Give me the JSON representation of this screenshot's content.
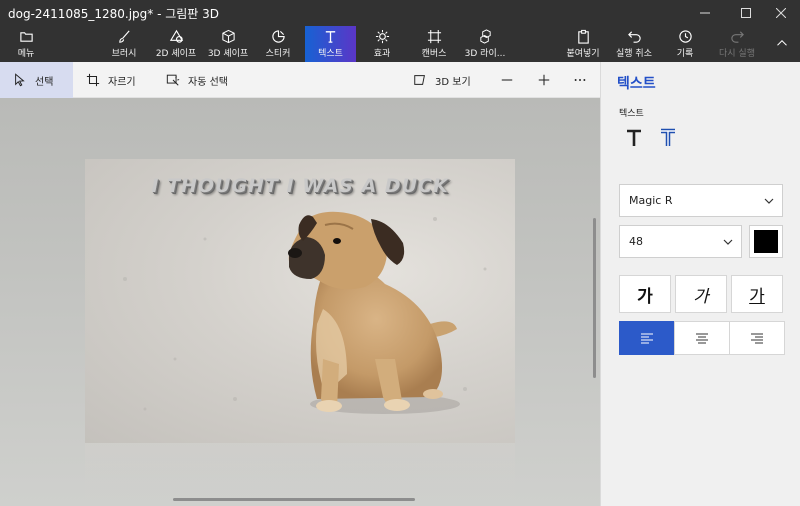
{
  "window": {
    "title": "dog-2411085_1280.jpg* - 그림판 3D",
    "minimize_icon": "minimize-icon",
    "maximize_icon": "maximize-icon",
    "close_icon": "close-icon"
  },
  "ribbon": {
    "menu_label": "메뉴",
    "tools": [
      {
        "label": "브러시",
        "icon": "brush-icon"
      },
      {
        "label": "2D 셰이프",
        "icon": "2d-shapes-icon"
      },
      {
        "label": "3D 셰이프",
        "icon": "3d-shapes-icon"
      },
      {
        "label": "스티커",
        "icon": "sticker-icon"
      },
      {
        "label": "텍스트",
        "icon": "text-icon",
        "active": true
      },
      {
        "label": "효과",
        "icon": "effects-icon"
      },
      {
        "label": "캔버스",
        "icon": "canvas-icon"
      },
      {
        "label": "3D 라이...",
        "icon": "3d-library-icon"
      }
    ],
    "paste_label": "붙여넣기",
    "undo_label": "실행 취소",
    "history_label": "기록",
    "redo_label": "다시 실행",
    "accent_start": "#1762d3",
    "accent_end": "#5b36c7"
  },
  "toolbar": {
    "select_label": "선택",
    "crop_label": "자르기",
    "magic_select_label": "자동 선택",
    "view3d_label": "3D 보기"
  },
  "canvas": {
    "overlay_text": "I THOUGHT I WAS A DUCK"
  },
  "panel": {
    "title": "텍스트",
    "text_type_label": "텍스트",
    "font_value": "Magic R",
    "size_value": "48",
    "color_value": "#000000",
    "bold_label": "가",
    "italic_label": "가",
    "underline_label": "가",
    "alignment_selected": "left",
    "accent_color": "#2c5ac9"
  }
}
